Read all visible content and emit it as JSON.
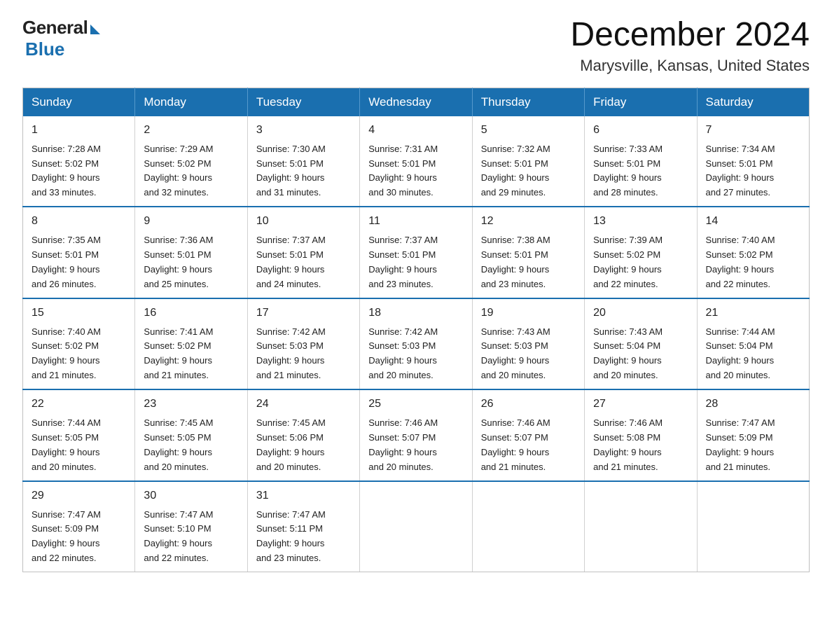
{
  "logo": {
    "general": "General",
    "blue": "Blue"
  },
  "title": "December 2024",
  "subtitle": "Marysville, Kansas, United States",
  "weekdays": [
    "Sunday",
    "Monday",
    "Tuesday",
    "Wednesday",
    "Thursday",
    "Friday",
    "Saturday"
  ],
  "weeks": [
    [
      {
        "day": "1",
        "sunrise": "7:28 AM",
        "sunset": "5:02 PM",
        "daylight": "9 hours and 33 minutes."
      },
      {
        "day": "2",
        "sunrise": "7:29 AM",
        "sunset": "5:02 PM",
        "daylight": "9 hours and 32 minutes."
      },
      {
        "day": "3",
        "sunrise": "7:30 AM",
        "sunset": "5:01 PM",
        "daylight": "9 hours and 31 minutes."
      },
      {
        "day": "4",
        "sunrise": "7:31 AM",
        "sunset": "5:01 PM",
        "daylight": "9 hours and 30 minutes."
      },
      {
        "day": "5",
        "sunrise": "7:32 AM",
        "sunset": "5:01 PM",
        "daylight": "9 hours and 29 minutes."
      },
      {
        "day": "6",
        "sunrise": "7:33 AM",
        "sunset": "5:01 PM",
        "daylight": "9 hours and 28 minutes."
      },
      {
        "day": "7",
        "sunrise": "7:34 AM",
        "sunset": "5:01 PM",
        "daylight": "9 hours and 27 minutes."
      }
    ],
    [
      {
        "day": "8",
        "sunrise": "7:35 AM",
        "sunset": "5:01 PM",
        "daylight": "9 hours and 26 minutes."
      },
      {
        "day": "9",
        "sunrise": "7:36 AM",
        "sunset": "5:01 PM",
        "daylight": "9 hours and 25 minutes."
      },
      {
        "day": "10",
        "sunrise": "7:37 AM",
        "sunset": "5:01 PM",
        "daylight": "9 hours and 24 minutes."
      },
      {
        "day": "11",
        "sunrise": "7:37 AM",
        "sunset": "5:01 PM",
        "daylight": "9 hours and 23 minutes."
      },
      {
        "day": "12",
        "sunrise": "7:38 AM",
        "sunset": "5:01 PM",
        "daylight": "9 hours and 23 minutes."
      },
      {
        "day": "13",
        "sunrise": "7:39 AM",
        "sunset": "5:02 PM",
        "daylight": "9 hours and 22 minutes."
      },
      {
        "day": "14",
        "sunrise": "7:40 AM",
        "sunset": "5:02 PM",
        "daylight": "9 hours and 22 minutes."
      }
    ],
    [
      {
        "day": "15",
        "sunrise": "7:40 AM",
        "sunset": "5:02 PM",
        "daylight": "9 hours and 21 minutes."
      },
      {
        "day": "16",
        "sunrise": "7:41 AM",
        "sunset": "5:02 PM",
        "daylight": "9 hours and 21 minutes."
      },
      {
        "day": "17",
        "sunrise": "7:42 AM",
        "sunset": "5:03 PM",
        "daylight": "9 hours and 21 minutes."
      },
      {
        "day": "18",
        "sunrise": "7:42 AM",
        "sunset": "5:03 PM",
        "daylight": "9 hours and 20 minutes."
      },
      {
        "day": "19",
        "sunrise": "7:43 AM",
        "sunset": "5:03 PM",
        "daylight": "9 hours and 20 minutes."
      },
      {
        "day": "20",
        "sunrise": "7:43 AM",
        "sunset": "5:04 PM",
        "daylight": "9 hours and 20 minutes."
      },
      {
        "day": "21",
        "sunrise": "7:44 AM",
        "sunset": "5:04 PM",
        "daylight": "9 hours and 20 minutes."
      }
    ],
    [
      {
        "day": "22",
        "sunrise": "7:44 AM",
        "sunset": "5:05 PM",
        "daylight": "9 hours and 20 minutes."
      },
      {
        "day": "23",
        "sunrise": "7:45 AM",
        "sunset": "5:05 PM",
        "daylight": "9 hours and 20 minutes."
      },
      {
        "day": "24",
        "sunrise": "7:45 AM",
        "sunset": "5:06 PM",
        "daylight": "9 hours and 20 minutes."
      },
      {
        "day": "25",
        "sunrise": "7:46 AM",
        "sunset": "5:07 PM",
        "daylight": "9 hours and 20 minutes."
      },
      {
        "day": "26",
        "sunrise": "7:46 AM",
        "sunset": "5:07 PM",
        "daylight": "9 hours and 21 minutes."
      },
      {
        "day": "27",
        "sunrise": "7:46 AM",
        "sunset": "5:08 PM",
        "daylight": "9 hours and 21 minutes."
      },
      {
        "day": "28",
        "sunrise": "7:47 AM",
        "sunset": "5:09 PM",
        "daylight": "9 hours and 21 minutes."
      }
    ],
    [
      {
        "day": "29",
        "sunrise": "7:47 AM",
        "sunset": "5:09 PM",
        "daylight": "9 hours and 22 minutes."
      },
      {
        "day": "30",
        "sunrise": "7:47 AM",
        "sunset": "5:10 PM",
        "daylight": "9 hours and 22 minutes."
      },
      {
        "day": "31",
        "sunrise": "7:47 AM",
        "sunset": "5:11 PM",
        "daylight": "9 hours and 23 minutes."
      },
      null,
      null,
      null,
      null
    ]
  ],
  "labels": {
    "sunrise": "Sunrise:",
    "sunset": "Sunset:",
    "daylight": "Daylight:"
  }
}
